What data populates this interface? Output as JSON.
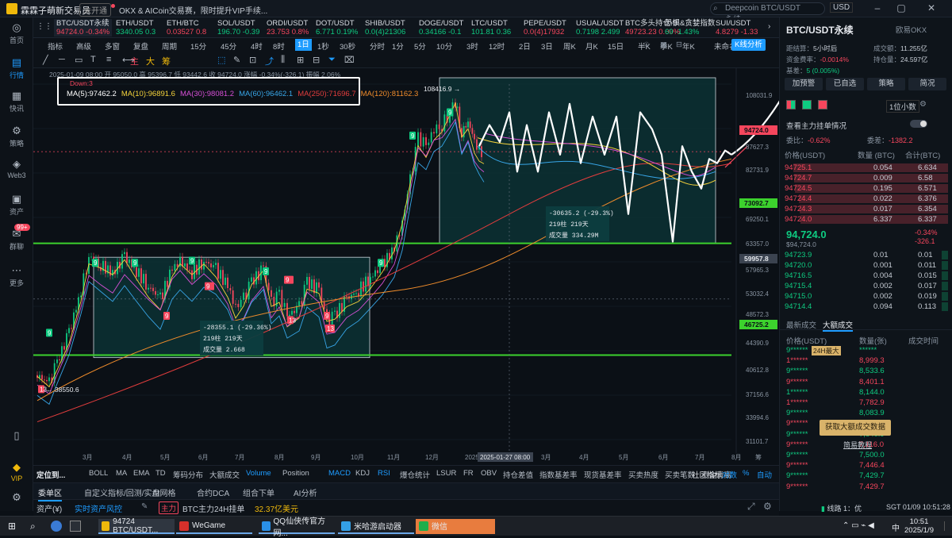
{
  "titlebar": {
    "app_name": "霖霖子萌新交易员",
    "badge": "未开通",
    "notice": "OKX & AICoin交易赛，限时提升VIP手续...",
    "search_placeholder": "Deepcoin BTC/USDT 永续",
    "currency": "USD"
  },
  "sidebar": [
    {
      "label": "首页",
      "icon": "home-icon",
      "glyph": "◎"
    },
    {
      "label": "行情",
      "icon": "market-icon",
      "glyph": "▤"
    },
    {
      "label": "快讯",
      "icon": "news-icon",
      "glyph": "▦"
    },
    {
      "label": "策略",
      "icon": "robot-icon",
      "glyph": "⚙"
    },
    {
      "label": "Web3",
      "icon": "web3-icon",
      "glyph": "◈"
    },
    {
      "label": "资产",
      "icon": "asset-icon",
      "glyph": "▣"
    },
    {
      "label": "群聊",
      "icon": "chat-icon",
      "glyph": "✉",
      "badge": "99+"
    },
    {
      "label": "更多",
      "icon": "more-icon",
      "glyph": "⋯"
    },
    {
      "label": "",
      "icon": "phone-icon",
      "glyph": "▯"
    },
    {
      "label": "VIP",
      "icon": "vip-icon",
      "glyph": "◆"
    },
    {
      "label": "",
      "icon": "settings-icon",
      "glyph": "⚙"
    }
  ],
  "tickers": [
    {
      "name": "BTC/USDT永续",
      "price": "94724.0",
      "change": "-0.34%",
      "dir": "dn"
    },
    {
      "name": "ETH/USDT",
      "price": "3340.05",
      "change": "0.3",
      "dir": "up"
    },
    {
      "name": "ETH/BTC",
      "price": "0.03527",
      "change": "0.8",
      "dir": "dn"
    },
    {
      "name": "SOL/USDT",
      "price": "196.70",
      "change": "-0.39",
      "dir": "up"
    },
    {
      "name": "ORDI/USDT",
      "price": "23.753",
      "change": "0.8%",
      "dir": "dn"
    },
    {
      "name": "DOT/USDT",
      "price": "6.771",
      "change": "0.19%",
      "dir": "up"
    },
    {
      "name": "SHIB/USDT",
      "price": "0.0(4)21306",
      "change": "",
      "dir": "up"
    },
    {
      "name": "DOGE/USDT",
      "price": "0.34166",
      "change": "-0.1",
      "dir": "up"
    },
    {
      "name": "LTC/USDT",
      "price": "101.81",
      "change": "0.36",
      "dir": "up"
    },
    {
      "name": "PEPE/USDT",
      "price": "0.0(4)17932",
      "change": "",
      "dir": "dn"
    },
    {
      "name": "USUAL/USDT",
      "price": "0.7198",
      "change": "2.499",
      "dir": "up"
    },
    {
      "name": "BTC多头持仓-B",
      "price": "49723.23",
      "change": "0.00%",
      "dir": "dn"
    },
    {
      "name": "恐惧&贪婪指数",
      "price": "69",
      "change": "-1.43%",
      "dir": "up"
    },
    {
      "name": "SUI/USDT",
      "price": "4.8279",
      "change": "-1.33",
      "dir": "dn"
    }
  ],
  "toolbar1": {
    "items": [
      "指标",
      "高级",
      "多窗",
      "复盘",
      "周期",
      "15分",
      "45分",
      "4时",
      "8时",
      "1日",
      "1秒",
      "30秒",
      "分时",
      "1分",
      "5分",
      "10分",
      "3时",
      "12时",
      "2日",
      "3日",
      "周K",
      "月K",
      "15日",
      "半K",
      "季K",
      "年K"
    ],
    "selected": "1日",
    "layout_name": "未命名",
    "kline_btn": "K线分析"
  },
  "chart": {
    "date_header": "2025-01-09 08:00 开 95050.0 高 95396.7 低 93442.6 收 94724.0 涨幅 -0.34%(-326.1) 振幅 2.06%",
    "down_label": "Down:3",
    "ma": [
      {
        "label": "MA(5):97462.2",
        "color": "#ffffff"
      },
      {
        "label": "MA(10):96891.6",
        "color": "#f5d33b"
      },
      {
        "label": "MA(30):98081.2",
        "color": "#d64fd6"
      },
      {
        "label": "MA(60):96462.1",
        "color": "#38a6e8"
      },
      {
        "label": "MA(250):71696.7",
        "color": "#e23d3d"
      },
      {
        "label": "MA(120):81162.3",
        "color": "#f08c2b"
      }
    ],
    "y_ticks": [
      "108031.9",
      "94724.0",
      "87627.3",
      "82731.9",
      "73092.7",
      "69250.1",
      "63357.0",
      "59957.8",
      "57965.3",
      "53032.4",
      "48572.3",
      "46725.2",
      "44390.9",
      "40612.8",
      "37156.6",
      "33994.6",
      "31101.7"
    ],
    "x_ticks": [
      "3月",
      "4月",
      "5月",
      "6月",
      "7月",
      "8月",
      "9月",
      "10月",
      "11月",
      "12月",
      "2025",
      "2025-01-27 08:00",
      "3月",
      "4月",
      "5月",
      "6月",
      "7月",
      "8月",
      "筹"
    ],
    "high_label": "108416.9",
    "low_label": "38550.6",
    "current_price": "94724.0",
    "line_upper": "73092.7",
    "line_lower": "46725.2",
    "line_mid": "59957.8",
    "box1": {
      "change": "-28355.1 (-29.36%)",
      "bars": "219柱 219天",
      "volume": "成交量 2.668"
    },
    "box2": {
      "change": "-30635.2 (-29.3%)",
      "bars": "219柱 219天",
      "volume": "成交量 334.29M"
    },
    "td_labels": [
      "9",
      "9",
      "9",
      "9",
      "9",
      "9",
      "9",
      "9",
      "13",
      "9",
      "13",
      "9",
      "13",
      "9",
      "9"
    ]
  },
  "bottom": {
    "indicator_tabs": [
      "定位到...",
      "BOLL",
      "MA",
      "EMA",
      "TD",
      "筹码分布",
      "大额成交",
      "Volume",
      "Position",
      "MACD",
      "KDJ",
      "RSI",
      "爆仓统计",
      "LSUR",
      "FR",
      "OBV",
      "持仓差值",
      "指数基差率",
      "现货基差率",
      "买卖热度",
      "买卖笔数",
      "资金背离"
    ],
    "active_indicators": [
      "Volume",
      "MACD",
      "RSI"
    ],
    "right_items": [
      "社区指标",
      "对数",
      "%",
      "自动"
    ],
    "order_tabs": [
      "委单区",
      "自定义指标/回测/实盘",
      "AI网格",
      "合约DCA",
      "组合下单",
      "AI分析"
    ],
    "asset_label": "资产(¥)",
    "risk_label": "实时资产风控",
    "main_tag": "主力",
    "main_text": "BTC主力24H挂单",
    "main_value": "32.37亿美元"
  },
  "rightpanel": {
    "pair": "BTC/USDT永续",
    "exchange": "欧易OKX",
    "funding_time_label": "距结算：",
    "funding_time": "5小时后",
    "funding_rate_label": "资金费率：",
    "funding_rate": "-0.0014%",
    "basis_label": "基差：",
    "basis": "5 (0.005%)",
    "vol_label": "成交额：",
    "vol": "11.255亿",
    "oi_label": "持仓量：",
    "oi": "24.597亿",
    "buttons": [
      "加预警",
      "已自选",
      "策略",
      "简况"
    ],
    "precision": "1位小数",
    "main_orders": "查看主力挂单情况",
    "ratio_label": "委比：",
    "ratio": "-0.62%",
    "diff_label": "委差：",
    "diff": "-1382.2",
    "ob_headers": [
      "价格(USDT)",
      "数量 (BTC)",
      "合计(BTC)"
    ],
    "asks": [
      [
        "94725.1",
        "0.054",
        "6.634"
      ],
      [
        "94724.7",
        "0.009",
        "6.58"
      ],
      [
        "94724.5",
        "0.195",
        "6.571"
      ],
      [
        "94724.4",
        "0.022",
        "6.376"
      ],
      [
        "94724.3",
        "0.017",
        "6.354"
      ],
      [
        "94724.0",
        "6.337",
        "6.337"
      ]
    ],
    "last_price": "94,724.0",
    "last_price_sub": "$94,724.0",
    "last_change": "-0.34%",
    "last_change_abs": "-326.1",
    "bids": [
      [
        "94723.9",
        "0.01",
        "0.01"
      ],
      [
        "94720.0",
        "0.001",
        "0.011"
      ],
      [
        "94716.5",
        "0.004",
        "0.015"
      ],
      [
        "94715.4",
        "0.002",
        "0.017"
      ],
      [
        "94715.0",
        "0.002",
        "0.019"
      ],
      [
        "94714.4",
        "0.094",
        "0.113"
      ]
    ],
    "trade_tabs": [
      "最新成交",
      "大额成交"
    ],
    "trade_headers": [
      "价格(USDT)",
      "数量(张)",
      "成交时间"
    ],
    "trades": [
      [
        "9******",
        "******",
        ""
      ],
      [
        "1******",
        "8,999.3",
        ""
      ],
      [
        "9******",
        "8,533.6",
        ""
      ],
      [
        "9******",
        "8,401.1",
        ""
      ],
      [
        "1******",
        "8,144.0",
        ""
      ],
      [
        "1******",
        "7,782.9",
        ""
      ],
      [
        "9******",
        "8,083.9",
        ""
      ],
      [
        "9******",
        "7,910.1",
        ""
      ],
      [
        "9******",
        "7,840.9",
        ""
      ],
      [
        "9******",
        "7,116.0",
        ""
      ],
      [
        "9******",
        "7,500.0",
        ""
      ],
      [
        "9******",
        "7,446.4",
        ""
      ],
      [
        "9******",
        "7,429.7",
        ""
      ],
      [
        "9******",
        "7,429.7",
        ""
      ]
    ],
    "max24h": "24H最大",
    "get_btn": "获取大额成交数据",
    "simple_tutorial": "简易教程",
    "line_status": "线路 1：优",
    "time": "SGT 01/09 10:51:28"
  },
  "taskbar": {
    "items": [
      "94724 BTC/USDT...",
      "WeGame",
      "QQ仙侠传官方网...",
      "米哈游启动器",
      "微信"
    ],
    "clock": "10:51",
    "date": "2025/1/9",
    "lang": "中"
  },
  "colors": {
    "up": "#0ecb81",
    "down": "#f6465d",
    "accent": "#1e9cff",
    "hline": "#3cd22d",
    "box": "#0f3a3d"
  }
}
